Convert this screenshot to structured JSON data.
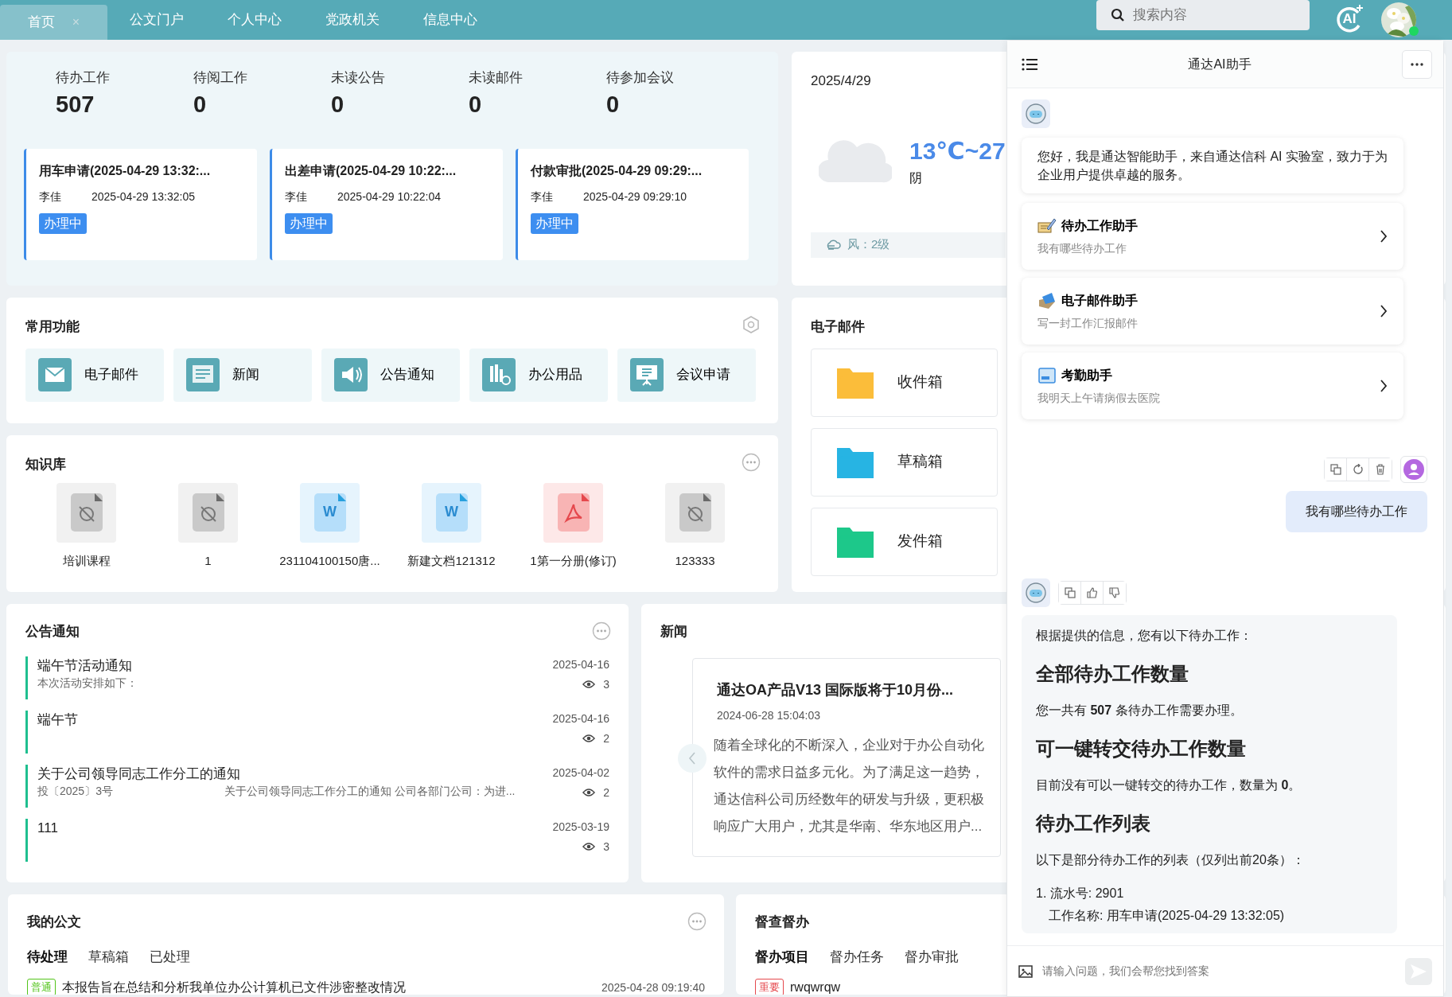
{
  "nav": {
    "tabs": [
      {
        "label": "首页",
        "selected": true,
        "close": "×"
      },
      {
        "label": "公文门户",
        "selected": false
      },
      {
        "label": "个人中心",
        "selected": false
      },
      {
        "label": "党政机关",
        "selected": false
      },
      {
        "label": "信息中心",
        "selected": false
      }
    ],
    "search": {
      "placeholder": "搜索内容"
    },
    "ai_button": "AI"
  },
  "stats": [
    {
      "label": "待办工作",
      "value": "507"
    },
    {
      "label": "待阅工作",
      "value": "0"
    },
    {
      "label": "未读公告",
      "value": "0"
    },
    {
      "label": "未读邮件",
      "value": "0"
    },
    {
      "label": "待参加会议",
      "value": "0"
    }
  ],
  "flows": [
    {
      "title": "用车申请(2025-04-29 13:32:...",
      "user": "李佳",
      "time": "2025-04-29 13:32:05",
      "status": "办理中"
    },
    {
      "title": "出差申请(2025-04-29 10:22:...",
      "user": "李佳",
      "time": "2025-04-29 10:22:04",
      "status": "办理中"
    },
    {
      "title": "付款审批(2025-04-29 09:29:...",
      "user": "李佳",
      "time": "2025-04-29 09:29:10",
      "status": "办理中"
    }
  ],
  "weather": {
    "date": "2025/4/29",
    "temperature": "13℃~27",
    "condition": "阴",
    "wind": "风：2级"
  },
  "shortcuts": {
    "title": "常用功能",
    "items": [
      {
        "label": "电子邮件",
        "kind": "mail"
      },
      {
        "label": "新闻",
        "kind": "news"
      },
      {
        "label": "公告通知",
        "kind": "speaker"
      },
      {
        "label": "办公用品",
        "kind": "supplies"
      },
      {
        "label": "会议申请",
        "kind": "meeting"
      }
    ]
  },
  "mail": {
    "title": "电子邮件",
    "folders": [
      {
        "label": "收件箱",
        "color": "#fbbd3a"
      },
      {
        "label": "草稿箱",
        "color": "#27b4e3"
      },
      {
        "label": "发件箱",
        "color": "#1dc88a"
      }
    ]
  },
  "knowledge": {
    "title": "知识库",
    "files": [
      {
        "name": "培训课程",
        "kind": "unknown"
      },
      {
        "name": "1",
        "kind": "unknown"
      },
      {
        "name": "231104100150唐...",
        "kind": "word",
        "letter": "W"
      },
      {
        "name": "新建文档121312",
        "kind": "word",
        "letter": "W"
      },
      {
        "name": "1第一分册(修订)",
        "kind": "pdf"
      },
      {
        "name": "123333",
        "kind": "unknown"
      }
    ]
  },
  "notices": {
    "title": "公告通知",
    "items": [
      {
        "title": "端午节活动通知",
        "summary": "本次活动安排如下：",
        "date": "2025-04-16",
        "views": "3"
      },
      {
        "title": "端午节",
        "date": "2025-04-16",
        "views": "2"
      },
      {
        "title": "关于公司领导同志工作分工的通知",
        "number": "投〔2025〕3号",
        "summary": "关于公司领导同志工作分工的通知 公司各部门公司：为进...",
        "date": "2025-04-02",
        "views": "2"
      },
      {
        "title": "111",
        "date": "2025-03-19",
        "views": "3"
      }
    ]
  },
  "news": {
    "title": "新闻",
    "article": {
      "title": "通达OA产品V13 国际版将于10月份...",
      "time": "2024-06-28 15:04:03",
      "body": "随着全球化的不断深入，企业对于办公自动化软件的需求日益多元化。为了满足这一趋势，通达信科公司历经数年的研发与升级，更积极响应广大用户，尤其是华南、华东地区用户..."
    }
  },
  "documents": {
    "title": "我的公文",
    "tabs": [
      {
        "label": "待处理",
        "selected": true
      },
      {
        "label": "草稿箱",
        "selected": false
      },
      {
        "label": "已处理",
        "selected": false
      }
    ],
    "rows": [
      {
        "tag": "普通",
        "color": "#52c41a",
        "title": "本报告旨在总结和分析我单位办公计算机已文件涉密整改情况",
        "time": "2025-04-28 09:19:40"
      }
    ]
  },
  "supervision": {
    "title": "督查督办",
    "tabs": [
      {
        "label": "督办项目",
        "selected": true
      },
      {
        "label": "督办任务",
        "selected": false
      },
      {
        "label": "督办审批",
        "selected": false
      }
    ],
    "rows": [
      {
        "tag": "重要",
        "color": "#e5484d",
        "title": "rwqwrqw"
      }
    ]
  },
  "assistant": {
    "title": "通达AI助手",
    "greeting": "您好，我是通达智能助手，来自通达信科 AI 实验室，致力于为企业用户提供卓越的服务。",
    "suggestions": [
      {
        "title": "待办工作助手",
        "prompt": "我有哪些待办工作",
        "kind": "todo"
      },
      {
        "title": "电子邮件助手",
        "prompt": "写一封工作汇报邮件",
        "kind": "mail"
      },
      {
        "title": "考勤助手",
        "prompt": "我明天上午请病假去医院",
        "kind": "attendance"
      }
    ],
    "question": "我有哪些待办工作",
    "answer": [
      {
        "kind": "p",
        "text": "根据提供的信息，您有以下待办工作："
      },
      {
        "kind": "h",
        "text": "全部待办工作数量"
      },
      {
        "kind": "p",
        "text": "您一共有 **507** 条待办工作需要办理。"
      },
      {
        "kind": "h",
        "text": "可一键转交待办工作数量"
      },
      {
        "kind": "p",
        "text": "目前没有可以一键转交的待办工作，数量为 **0**。"
      },
      {
        "kind": "h",
        "text": "待办工作列表"
      },
      {
        "kind": "p",
        "text": "以下是部分待办工作的列表（仅列出前20条）："
      },
      {
        "kind": "item",
        "text": "1. 流水号: 2901"
      },
      {
        "kind": "sub",
        "text": "工作名称: 用车申请(2025-04-29 13:32:05)"
      }
    ],
    "input": {
      "placeholder": "请输入问题，我们会帮您找到答案"
    }
  }
}
